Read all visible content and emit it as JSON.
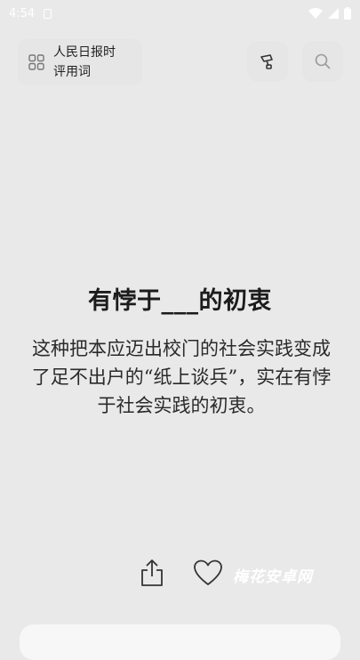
{
  "status_bar": {
    "time": "4:54"
  },
  "header": {
    "title": "人民日报时评用词"
  },
  "term": {
    "word": "有悖于___的初衷"
  },
  "example": {
    "sentence": "这种把本应迈出校门的社会实践变成了足不出户的“纸上谈兵”，实在有悖于社会实践的初衷。"
  },
  "watermark": {
    "text": "梅花安卓网"
  },
  "icons": {
    "grid": "grid-icon",
    "stamp": "stamp-icon",
    "search": "search-icon",
    "share": "share-icon",
    "like": "heart-icon"
  },
  "colors": {
    "background": "#e9e9e9",
    "card": "#e6e6e6",
    "text": "#1c1c1c"
  }
}
